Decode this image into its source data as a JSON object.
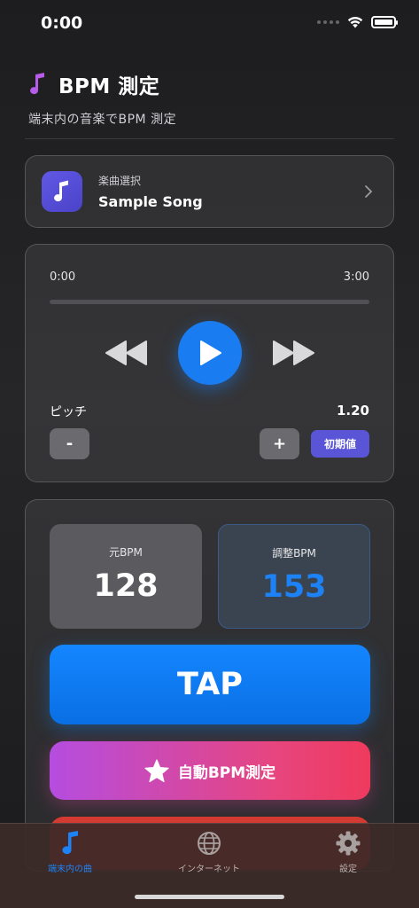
{
  "status_bar": {
    "time": "0:00"
  },
  "header": {
    "title": "BPM 測定",
    "subtitle": "端末内の音楽でBPM 測定",
    "icon": "music-note-icon",
    "icon_color": "#b75ce8"
  },
  "song": {
    "caption": "楽曲選択",
    "name": "Sample Song"
  },
  "player": {
    "current_time": "0:00",
    "total_time": "3:00",
    "progress": 0,
    "pitch_label": "ピッチ",
    "pitch_value": "1.20",
    "minus_label": "-",
    "plus_label": "+",
    "reset_label": "初期値"
  },
  "bpm": {
    "original_label": "元BPM",
    "original_value": "128",
    "adjusted_label": "調整BPM",
    "adjusted_value": "153",
    "tap_label": "TAP",
    "auto_label": "自動BPM測定"
  },
  "colors": {
    "accent": "#1d82f5",
    "tap": "#1486ff",
    "reset": "#5a55d6"
  },
  "tabs": [
    {
      "label": "端末内の曲",
      "icon": "music-note-icon",
      "active": true
    },
    {
      "label": "インターネット",
      "icon": "globe-icon",
      "active": false
    },
    {
      "label": "設定",
      "icon": "gear-icon",
      "active": false
    }
  ]
}
